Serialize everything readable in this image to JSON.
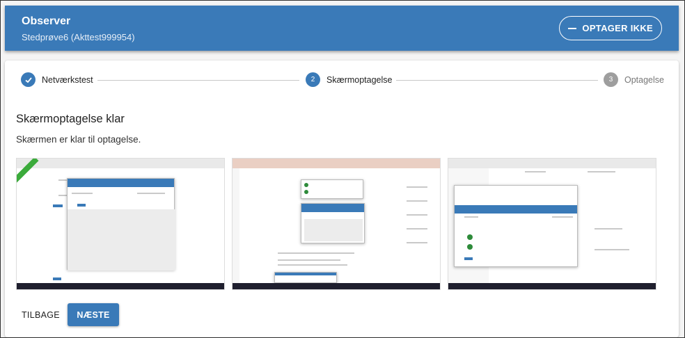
{
  "header": {
    "title": "Observer",
    "subtitle": "Stedprøve6 (Akttest999954)",
    "record_button": "OPTAGER IKKE"
  },
  "stepper": {
    "steps": [
      {
        "number": "",
        "label": "Netværkstest",
        "state": "done"
      },
      {
        "number": "2",
        "label": "Skærmoptagelse",
        "state": "active"
      },
      {
        "number": "3",
        "label": "Optagelse",
        "state": "pending"
      }
    ]
  },
  "main": {
    "title": "Skærmoptagelse klar",
    "description": "Skærmen er klar til optagelse."
  },
  "thumbnails": [
    {
      "icon": "screen-preview-1"
    },
    {
      "icon": "screen-preview-2"
    },
    {
      "icon": "screen-preview-3"
    }
  ],
  "actions": {
    "back": "TILBAGE",
    "next": "NÆSTE"
  },
  "colors": {
    "primary": "#3a7ab8",
    "pending": "#9e9e9e"
  }
}
